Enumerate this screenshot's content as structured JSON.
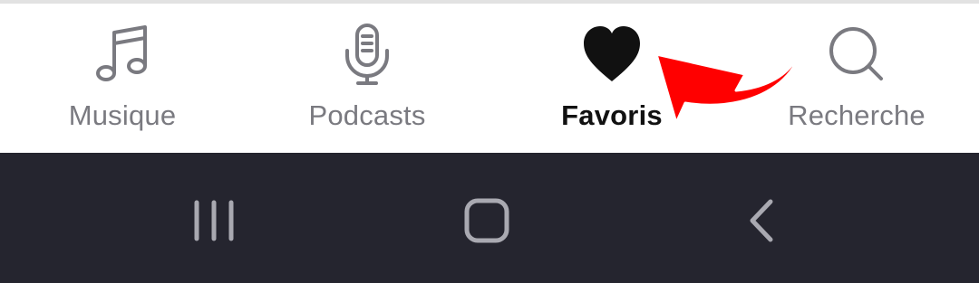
{
  "colors": {
    "tab_inactive": "#7a7a80",
    "tab_active": "#111111",
    "nav_background": "#25252f",
    "nav_icon": "#a9a9b1",
    "annotation_arrow": "#ff0000"
  },
  "tabs": [
    {
      "label": "Musique",
      "icon": "music-note-icon",
      "active": false
    },
    {
      "label": "Podcasts",
      "icon": "microphone-icon",
      "active": false
    },
    {
      "label": "Favoris",
      "icon": "heart-icon",
      "active": true
    },
    {
      "label": "Recherche",
      "icon": "search-icon",
      "active": false
    }
  ],
  "annotation": {
    "icon": "curved-arrow-icon",
    "points_to": "Favoris"
  },
  "system_nav": {
    "recents_icon": "recent-apps-icon",
    "home_icon": "home-icon",
    "back_icon": "back-icon"
  }
}
